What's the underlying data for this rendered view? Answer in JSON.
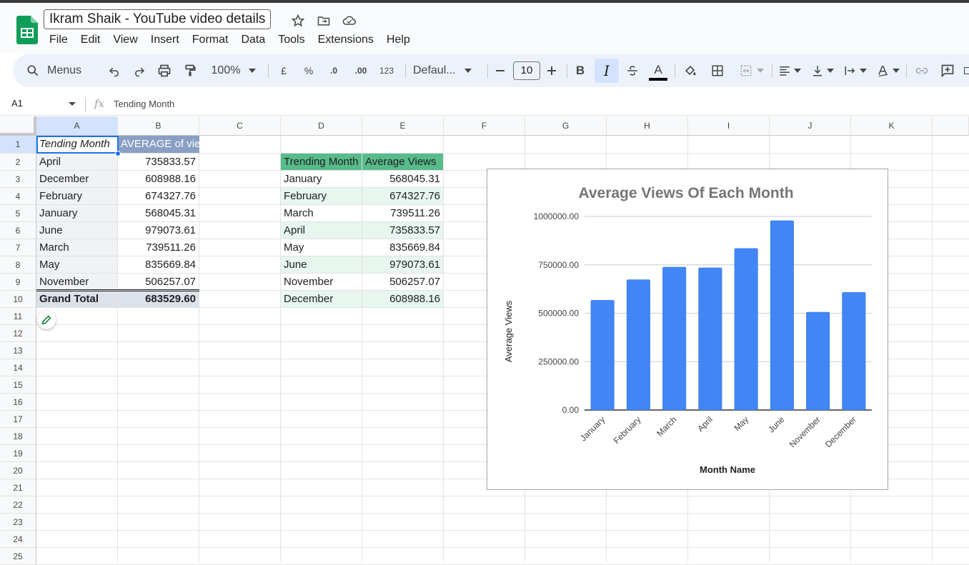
{
  "document": {
    "title": "Ikram Shaik - YouTube video details"
  },
  "menu": [
    "File",
    "Edit",
    "View",
    "Insert",
    "Format",
    "Data",
    "Tools",
    "Extensions",
    "Help"
  ],
  "toolbar": {
    "search_label": "Menus",
    "zoom": "100%",
    "currency": "£",
    "percent": "%",
    "decrease_decimal": ".0",
    "increase_decimal": ".00",
    "number_format": "123",
    "font": "Defaul...",
    "font_size": "10",
    "bold": "B",
    "italic": "I",
    "text_color_label": "A"
  },
  "formula_bar": {
    "cell_ref": "A1",
    "value": "Tending Month"
  },
  "columns": [
    "A",
    "B",
    "C",
    "D",
    "E",
    "F",
    "G",
    "H",
    "I",
    "J",
    "K"
  ],
  "rows": [
    "1",
    "2",
    "3",
    "4",
    "5",
    "6",
    "7",
    "8",
    "9",
    "10",
    "11",
    "12",
    "13",
    "14",
    "15",
    "16",
    "17",
    "18",
    "19",
    "20",
    "21",
    "22",
    "23",
    "24",
    "25"
  ],
  "pivot": {
    "header_a": "Tending Month",
    "header_b": "AVERAGE of vie",
    "rows": [
      {
        "month": "April",
        "avg": "735833.57"
      },
      {
        "month": "December",
        "avg": "608988.16"
      },
      {
        "month": "February",
        "avg": "674327.76"
      },
      {
        "month": "January",
        "avg": "568045.31"
      },
      {
        "month": "June",
        "avg": "979073.61"
      },
      {
        "month": "March",
        "avg": "739511.26"
      },
      {
        "month": "May",
        "avg": "835669.84"
      },
      {
        "month": "November",
        "avg": "506257.07"
      }
    ],
    "total_label": "Grand Total",
    "total_value": "683529.60"
  },
  "table2": {
    "header_d": "Trending Month",
    "header_e": "Average Views",
    "rows": [
      {
        "month": "January",
        "avg": "568045.31"
      },
      {
        "month": "February",
        "avg": "674327.76"
      },
      {
        "month": "March",
        "avg": "739511.26"
      },
      {
        "month": "April",
        "avg": "735833.57"
      },
      {
        "month": "May",
        "avg": "835669.84"
      },
      {
        "month": "June",
        "avg": "979073.61"
      },
      {
        "month": "November",
        "avg": "506257.07"
      },
      {
        "month": "December",
        "avg": "608988.16"
      }
    ]
  },
  "colors": {
    "bar": "#4285f4",
    "pivot_header": "#8a9fc4",
    "table_header": "#57bb8a",
    "table_band": "#e7f6ee",
    "selection": "#1a73e8",
    "sheets_green": "#0f9d58"
  },
  "chart_data": {
    "type": "bar",
    "title": "Average Views Of Each Month",
    "xlabel": "Month Name",
    "ylabel": "Average Views",
    "categories": [
      "January",
      "February",
      "March",
      "April",
      "May",
      "June",
      "November",
      "December"
    ],
    "values": [
      568045.31,
      674327.76,
      739511.26,
      735833.57,
      835669.84,
      979073.61,
      506257.07,
      608988.16
    ],
    "ylim": [
      0,
      1000000
    ],
    "yticks": [
      "0.00",
      "250000.00",
      "500000.00",
      "750000.00",
      "1000000.00"
    ],
    "grid": true,
    "legend": "none"
  }
}
